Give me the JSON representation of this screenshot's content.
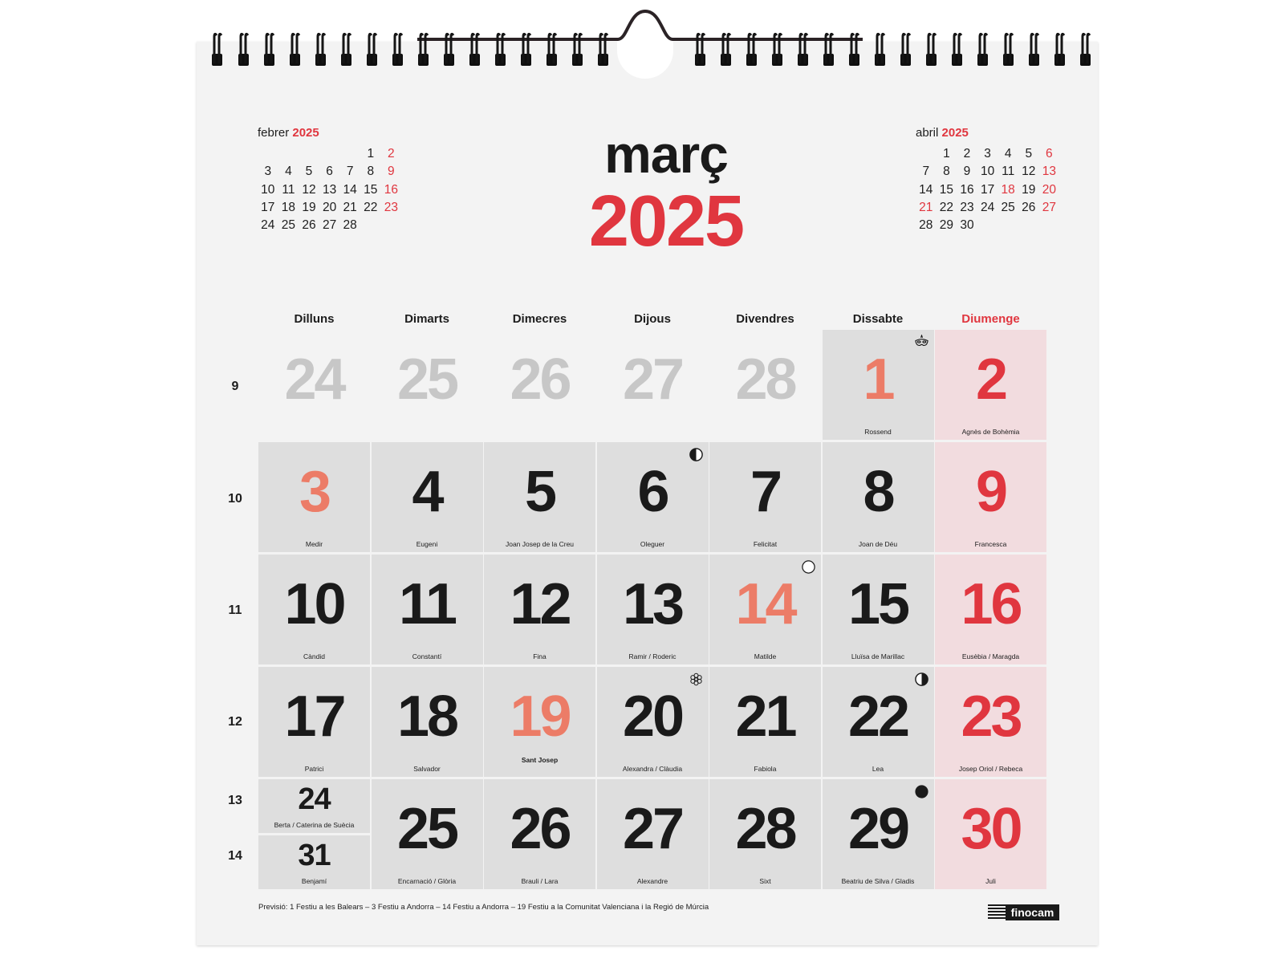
{
  "mini_prev": {
    "month": "febrer",
    "year": "2025",
    "days": [
      "",
      "",
      "",
      "",
      "",
      "1",
      "2",
      "3",
      "4",
      "5",
      "6",
      "7",
      "8",
      "9",
      "10",
      "11",
      "12",
      "13",
      "14",
      "15",
      "16",
      "17",
      "18",
      "19",
      "20",
      "21",
      "22",
      "23",
      "24",
      "25",
      "26",
      "27",
      "28"
    ],
    "red_days": [
      "2",
      "9",
      "16",
      "23"
    ]
  },
  "mini_next": {
    "month": "abril",
    "year": "2025",
    "days": [
      "",
      "1",
      "2",
      "3",
      "4",
      "5",
      "6",
      "7",
      "8",
      "9",
      "10",
      "11",
      "12",
      "13",
      "14",
      "15",
      "16",
      "17",
      "18",
      "19",
      "20",
      "21",
      "22",
      "23",
      "24",
      "25",
      "26",
      "27",
      "28",
      "29",
      "30"
    ],
    "red_days": [
      "6",
      "13",
      "18",
      "20",
      "21",
      "27"
    ]
  },
  "title": {
    "month": "març",
    "year": "2025"
  },
  "weekdays": [
    "Dilluns",
    "Dimarts",
    "Dimecres",
    "Dijous",
    "Divendres",
    "Dissabte",
    "Diumenge"
  ],
  "week_numbers": [
    "9",
    "10",
    "11",
    "12",
    "13",
    "14"
  ],
  "weeks": [
    [
      {
        "day": "24",
        "style": "grey",
        "saint": "",
        "bg": "ghost"
      },
      {
        "day": "25",
        "style": "grey",
        "saint": "",
        "bg": "ghost"
      },
      {
        "day": "26",
        "style": "grey",
        "saint": "",
        "bg": "ghost"
      },
      {
        "day": "27",
        "style": "grey",
        "saint": "",
        "bg": "ghost"
      },
      {
        "day": "28",
        "style": "grey",
        "saint": "",
        "bg": "ghost"
      },
      {
        "day": "1",
        "style": "salmon",
        "saint": "Rossend",
        "bg": "normal",
        "marker": "carnival-mask-icon"
      },
      {
        "day": "2",
        "style": "red",
        "saint": "Agnès de Bohèmia",
        "bg": "sunday"
      }
    ],
    [
      {
        "day": "3",
        "style": "salmon",
        "saint": "Medir",
        "bg": "normal"
      },
      {
        "day": "4",
        "style": "black",
        "saint": "Eugeni",
        "bg": "normal"
      },
      {
        "day": "5",
        "style": "black",
        "saint": "Joan Josep de la Creu",
        "bg": "normal"
      },
      {
        "day": "6",
        "style": "black",
        "saint": "Oleguer",
        "bg": "normal",
        "marker": "first-quarter-moon-icon"
      },
      {
        "day": "7",
        "style": "black",
        "saint": "Felicitat",
        "bg": "normal"
      },
      {
        "day": "8",
        "style": "black",
        "saint": "Joan de Déu",
        "bg": "normal"
      },
      {
        "day": "9",
        "style": "red",
        "saint": "Francesca",
        "bg": "sunday"
      }
    ],
    [
      {
        "day": "10",
        "style": "black",
        "saint": "Càndid",
        "bg": "normal"
      },
      {
        "day": "11",
        "style": "black",
        "saint": "Constantí",
        "bg": "normal"
      },
      {
        "day": "12",
        "style": "black",
        "saint": "Fina",
        "bg": "normal"
      },
      {
        "day": "13",
        "style": "black",
        "saint": "Ramir / Roderic",
        "bg": "normal"
      },
      {
        "day": "14",
        "style": "salmon",
        "saint": "Matilde",
        "bg": "normal",
        "marker": "full-moon-icon"
      },
      {
        "day": "15",
        "style": "black",
        "saint": "Lluïsa de Marillac",
        "bg": "normal"
      },
      {
        "day": "16",
        "style": "red",
        "saint": "Eusèbia / Maragda",
        "bg": "sunday"
      }
    ],
    [
      {
        "day": "17",
        "style": "black",
        "saint": "Patrici",
        "bg": "normal"
      },
      {
        "day": "18",
        "style": "black",
        "saint": "Salvador",
        "bg": "normal"
      },
      {
        "day": "19",
        "style": "salmon",
        "saint": "Sant Josep",
        "bg": "normal",
        "saint_bold": true
      },
      {
        "day": "20",
        "style": "black",
        "saint": "Alexandra / Clàudia",
        "bg": "normal",
        "marker": "spring-flower-icon"
      },
      {
        "day": "21",
        "style": "black",
        "saint": "Fabiola",
        "bg": "normal"
      },
      {
        "day": "22",
        "style": "black",
        "saint": "Lea",
        "bg": "normal",
        "marker": "last-quarter-moon-icon"
      },
      {
        "day": "23",
        "style": "red",
        "saint": "Josep Oriol / Rebeca",
        "bg": "sunday"
      }
    ],
    [
      {
        "day": "",
        "style": "black",
        "saint": "",
        "bg": "split"
      },
      {
        "day": "25",
        "style": "black",
        "saint": "Encarnació / Glòria",
        "bg": "normal"
      },
      {
        "day": "26",
        "style": "black",
        "saint": "Brauli / Lara",
        "bg": "normal"
      },
      {
        "day": "27",
        "style": "black",
        "saint": "Alexandre",
        "bg": "normal"
      },
      {
        "day": "28",
        "style": "black",
        "saint": "Sixt",
        "bg": "normal"
      },
      {
        "day": "29",
        "style": "black",
        "saint": "Beatriu de Silva / Gladis",
        "bg": "normal",
        "marker": "new-moon-icon"
      },
      {
        "day": "30",
        "style": "red",
        "saint": "Juli",
        "bg": "sunday"
      }
    ]
  ],
  "split_cell": [
    {
      "day": "24",
      "saint": "Berta / Caterina de Suècia"
    },
    {
      "day": "31",
      "saint": "Benjamí"
    }
  ],
  "footer_note": "Previsió: 1 Festiu a les Balears – 3 Festiu a Andorra – 14 Festiu a Andorra – 19 Festiu a la Comunitat Valenciana i la Regió de Múrcia",
  "brand": "finocam",
  "colors": {
    "accent_red": "#e0363f",
    "holiday_salmon": "#ec7c67",
    "sunday_bg": "#f2dcdf",
    "cell_bg": "#dedede",
    "ghost_text": "#c7c7c7"
  }
}
